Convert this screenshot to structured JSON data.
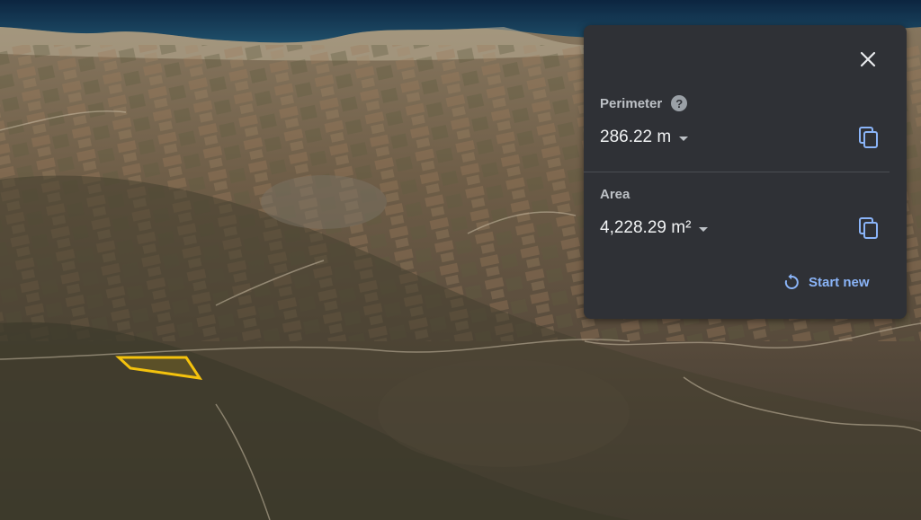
{
  "map": {
    "polygon_color": "#f4c20d",
    "view": "satellite-3d"
  },
  "panel": {
    "close_icon": "close-icon",
    "perimeter": {
      "label": "Perimeter",
      "help_icon": "?",
      "value": "286.22 m"
    },
    "area": {
      "label": "Area",
      "value": "4,228.29 m²"
    },
    "copy_icon": "copy-icon",
    "start_new_label": "Start new",
    "accent_color": "#8ab4f8"
  }
}
